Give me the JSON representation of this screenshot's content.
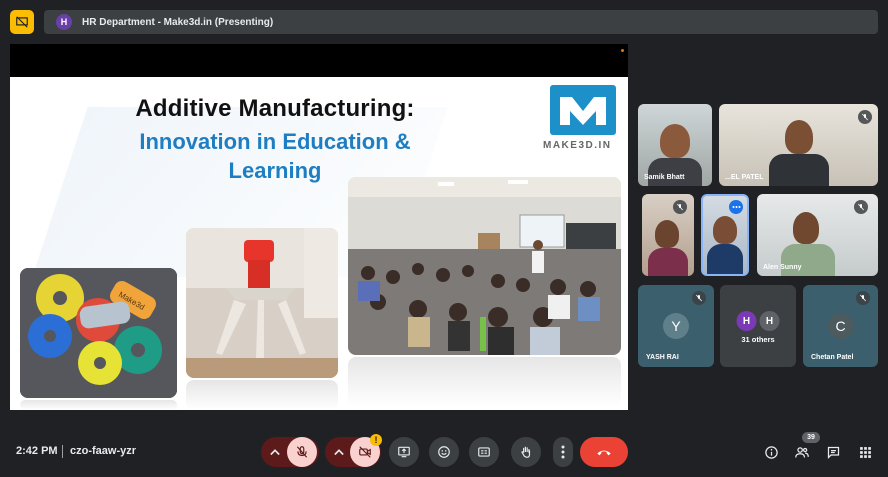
{
  "header": {
    "avatar_letter": "H",
    "title": "HR Department - Make3d.in (Presenting)"
  },
  "slide": {
    "title_line1": "Additive Manufacturing:",
    "title_line2": "Innovation in Education &",
    "title_line3": "Learning",
    "logo_text": "MAKE3D.IN",
    "wristband_text": "Make3d"
  },
  "participants": [
    {
      "name": "Samik Bhatt",
      "muted": false
    },
    {
      "name": "...EL PATEL",
      "muted": true
    },
    {
      "name": "",
      "muted": true
    },
    {
      "name": "",
      "muted": false
    },
    {
      "name": "Alen Sunny",
      "muted": true
    },
    {
      "name": "YASH RAI",
      "avatar": "Y",
      "muted": true
    },
    {
      "name": "Chetan Patel",
      "avatar": "C",
      "muted": true
    }
  ],
  "others": {
    "avatars": [
      "H",
      "H"
    ],
    "label": "31 others"
  },
  "footer": {
    "time": "2:42 PM",
    "meeting_code": "czo-faaw-yzr",
    "people_count": "39",
    "warning_mark": "!"
  },
  "colors": {
    "background": "#202124",
    "accent": "#1f7ec2",
    "end_call": "#ea4335",
    "warning": "#fbbc04",
    "muted_control": "#f9d2d0"
  },
  "icons": {
    "present_off": "present-off-icon",
    "mic_off": "mic-off-icon",
    "cam_off": "cam-off-icon",
    "present": "present-icon",
    "emoji": "emoji-icon",
    "captions": "captions-icon",
    "hand": "raise-hand-icon",
    "more": "more-vert-icon",
    "end": "end-call-icon",
    "info": "info-icon",
    "people": "people-icon",
    "chat": "chat-icon",
    "activities": "grid-icon"
  }
}
